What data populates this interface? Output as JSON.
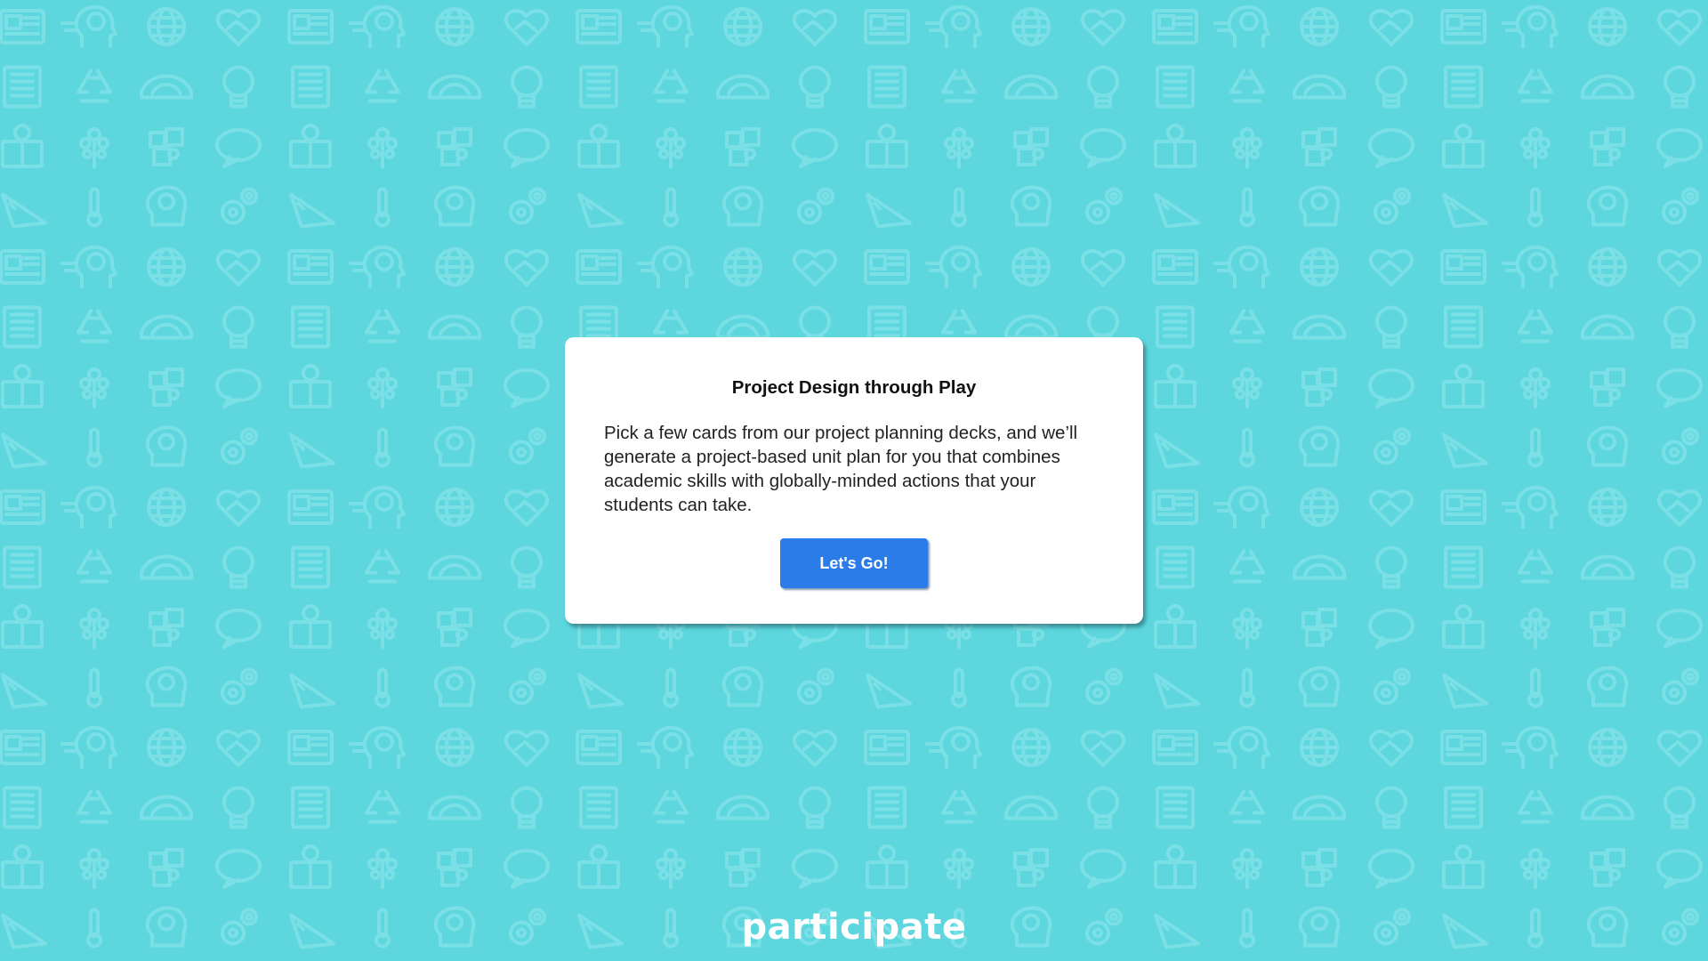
{
  "background": {
    "color": "#5dd6de",
    "pattern_color": "#7ae0e6",
    "pattern_icons": [
      "newspaper-icon",
      "head-question-icon",
      "globe-icon",
      "heart-handshake-icon",
      "book-icon",
      "recycle-icon",
      "protractor-icon",
      "lightbulb-icon",
      "tree-icon",
      "puzzle-icon",
      "speech-bubble-icon",
      "reading-icon",
      "triangle-ruler-icon",
      "thermometer-icon",
      "brain-head-icon",
      "gears-icon"
    ]
  },
  "card": {
    "title": "Project Design through Play",
    "body": "Pick a few cards from our project planning decks, and we’ll generate a project-based unit plan for you that combines academic skills with globally-minded actions that your students can take.",
    "button_label": "Let's Go!",
    "button_color": "#2b7be9"
  },
  "footer": {
    "logo_text": "participate"
  }
}
